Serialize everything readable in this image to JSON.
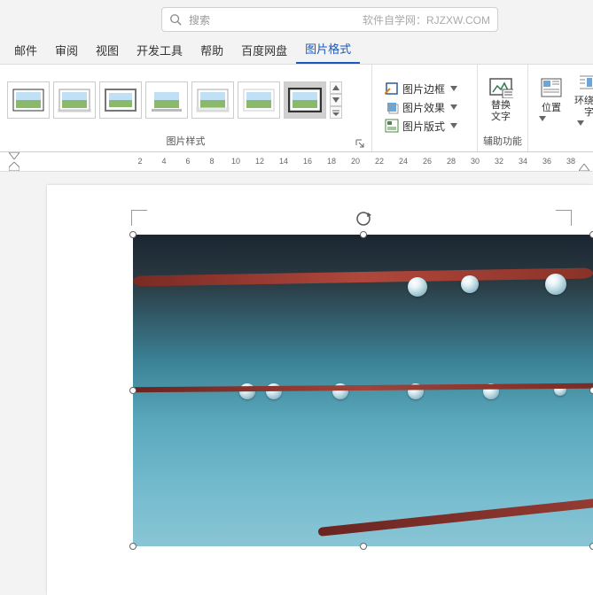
{
  "search": {
    "placeholder": "搜索",
    "watermark": "软件自学网：RJZXW.COM"
  },
  "tabs": {
    "items": [
      "邮件",
      "审阅",
      "视图",
      "开发工具",
      "帮助",
      "百度网盘",
      "图片格式"
    ],
    "active": 6
  },
  "ribbon": {
    "styles_label": "图片样式",
    "format_menu": {
      "border": "图片边框",
      "effects": "图片效果",
      "layout": "图片版式"
    },
    "alt_text": "替换\n文字",
    "alt_group": "辅助功能",
    "position": "位置",
    "wrap": "环绕文\n字"
  },
  "ruler": {
    "numbers": [
      2,
      4,
      6,
      8,
      10,
      12,
      14,
      16,
      18,
      20,
      22,
      24,
      26,
      28,
      30,
      32,
      34,
      36,
      38
    ]
  }
}
